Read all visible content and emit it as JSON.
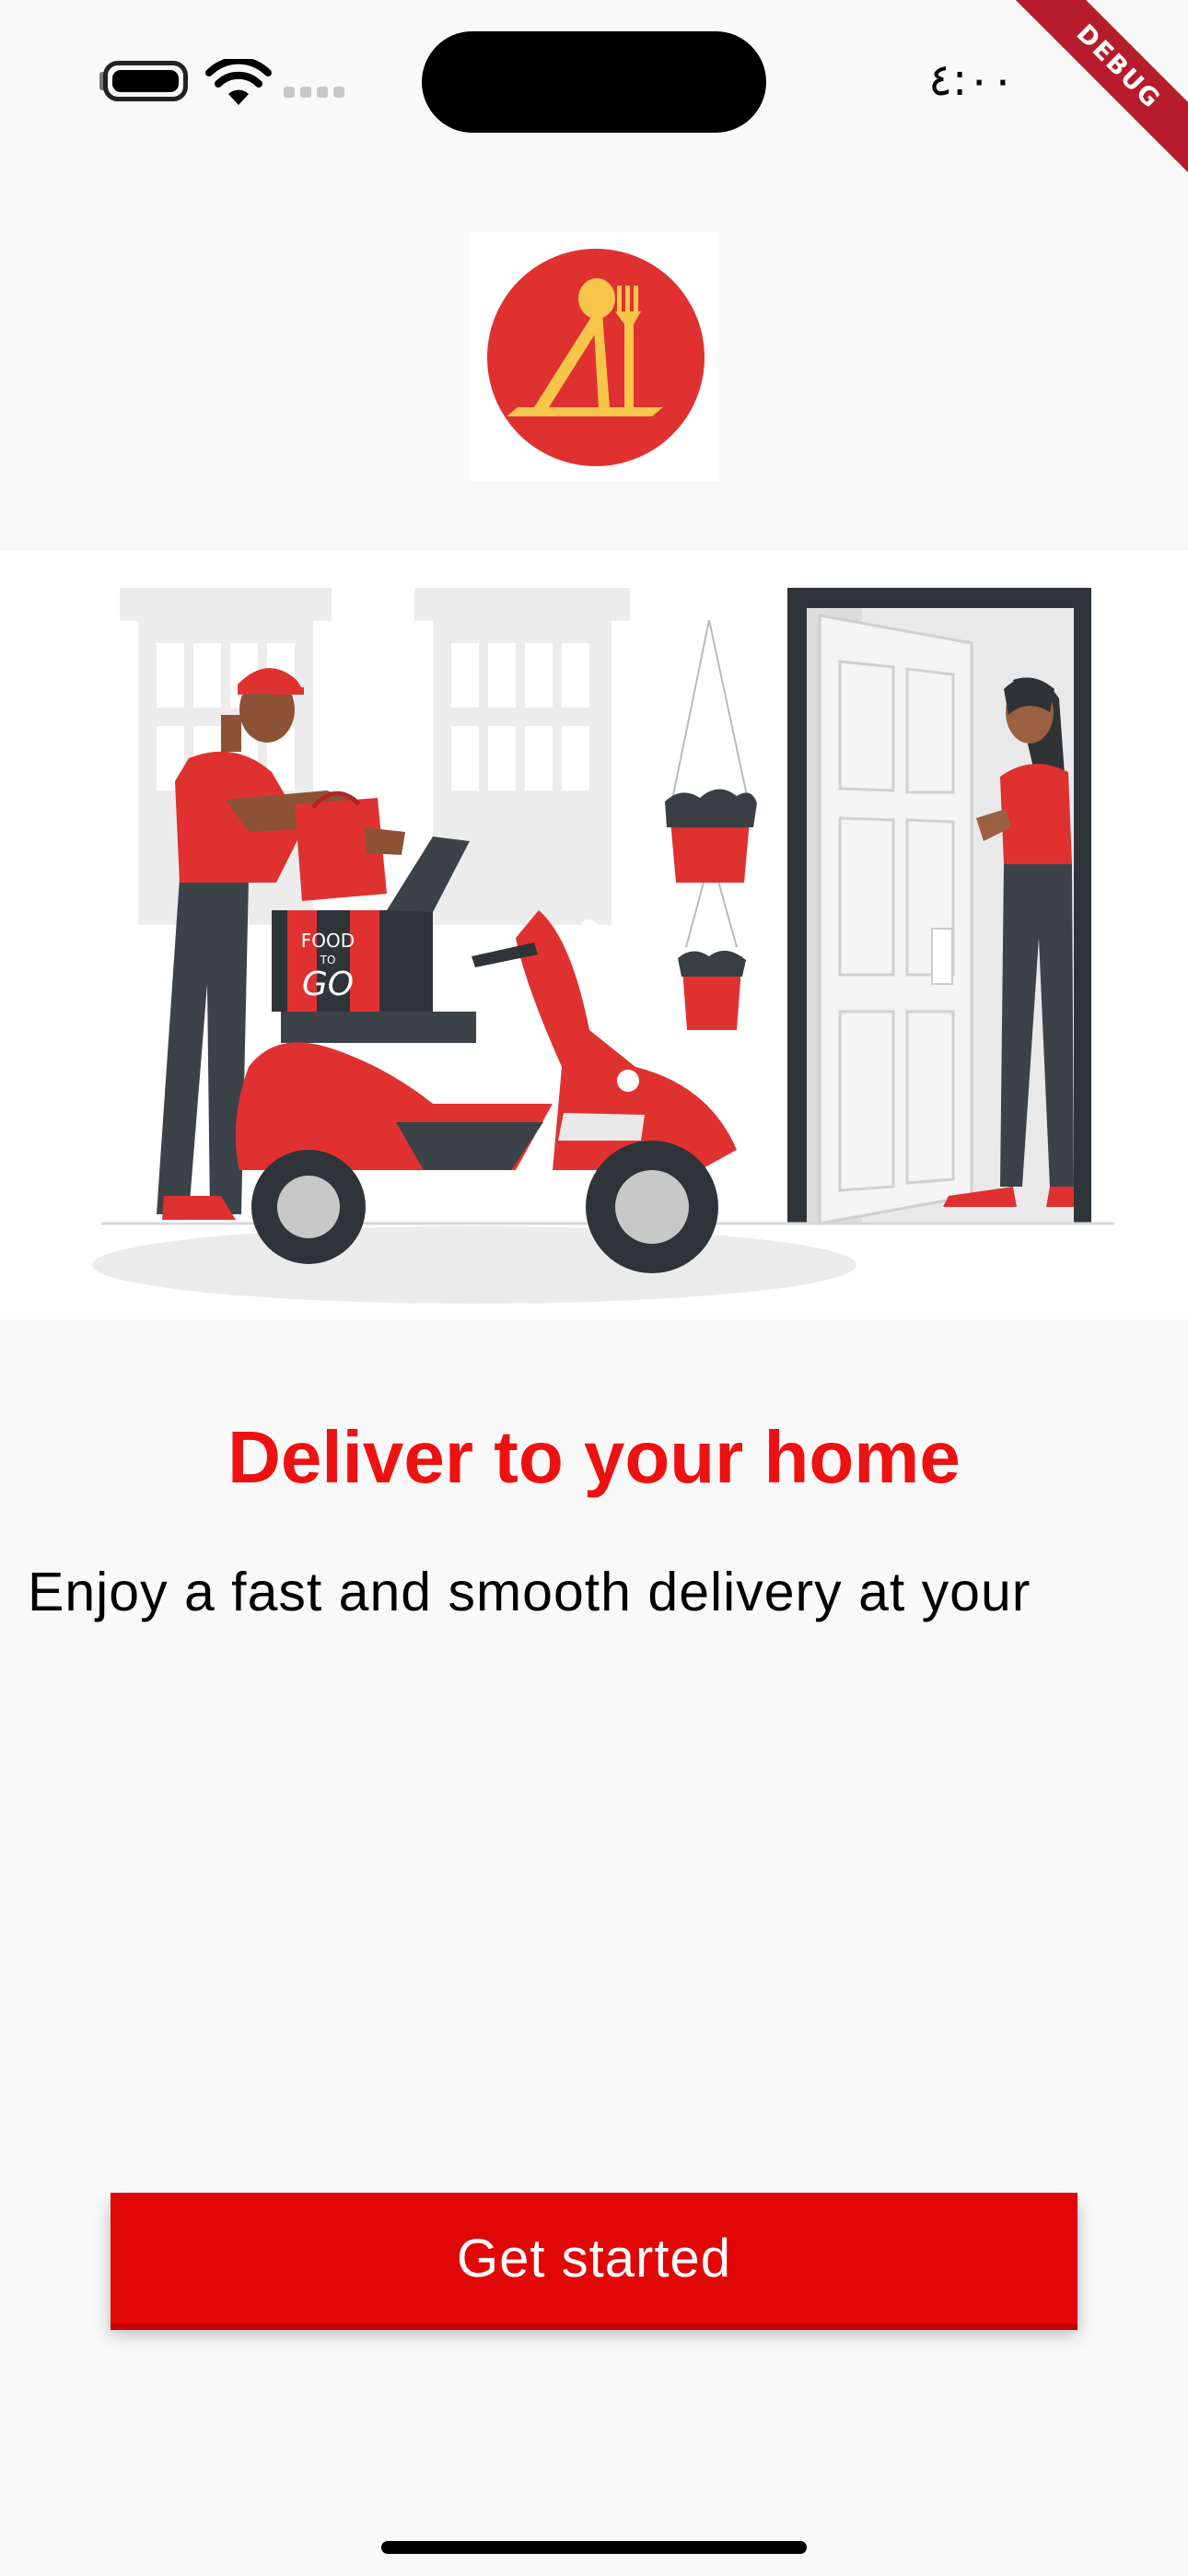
{
  "status_bar": {
    "time": "٤:٠٠",
    "icons": [
      "battery-icon",
      "wifi-icon",
      "cellular-signal-icon"
    ]
  },
  "debug_banner": "DEBUG",
  "logo": {
    "icon": "restaurant-logo-icon",
    "colors": {
      "circle": "#e03131",
      "glyph": "#f6c54a"
    }
  },
  "illustration": {
    "icon": "delivery-scooter-illustration",
    "box_text": [
      "FOOD",
      "TO",
      "GO"
    ]
  },
  "onboarding": {
    "title": "Deliver to your home",
    "description": "Enjoy a fast and smooth delivery at your"
  },
  "actions": {
    "get_started_label": "Get started"
  },
  "colors": {
    "accent": "#ee1111",
    "button": "#e10707",
    "background": "#f9f9f9"
  }
}
